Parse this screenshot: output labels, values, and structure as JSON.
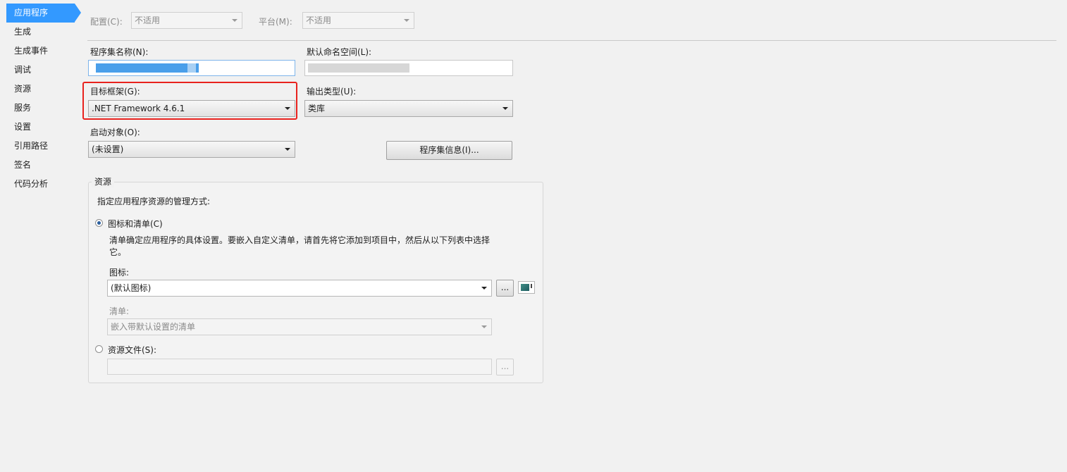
{
  "nav": {
    "items": [
      {
        "label": "应用程序",
        "active": true
      },
      {
        "label": "生成"
      },
      {
        "label": "生成事件"
      },
      {
        "label": "调试"
      },
      {
        "label": "资源"
      },
      {
        "label": "服务"
      },
      {
        "label": "设置"
      },
      {
        "label": "引用路径"
      },
      {
        "label": "签名"
      },
      {
        "label": "代码分析"
      }
    ]
  },
  "top": {
    "config_label": "配置(C):",
    "config_value": "不适用",
    "platform_label": "平台(M):",
    "platform_value": "不适用"
  },
  "form": {
    "assembly_name_label": "程序集名称(N):",
    "default_namespace_label": "默认命名空间(L):",
    "target_framework_label": "目标框架(G):",
    "target_framework_value": ".NET Framework 4.6.1",
    "output_type_label": "输出类型(U):",
    "output_type_value": "类库",
    "startup_object_label": "启动对象(O):",
    "startup_object_value": "(未设置)",
    "assembly_info_button": "程序集信息(I)..."
  },
  "resources": {
    "title": "资源",
    "description": "指定应用程序资源的管理方式:",
    "icon_manifest_radio": "图标和清单(C)",
    "icon_manifest_help_line1": "清单确定应用程序的具体设置。要嵌入自定义清单，请首先将它添加到项目中，然后从以下列表中选择",
    "icon_manifest_help_line2": "它。",
    "icon_label": "图标:",
    "icon_value": "(默认图标)",
    "browse_label": "...",
    "manifest_label": "清单:",
    "manifest_value": "嵌入带默认设置的清单",
    "resource_file_radio": "资源文件(S):",
    "resource_file_value": ""
  },
  "colors": {
    "accent": "#3399ff",
    "highlight_border": "#e8221e"
  }
}
